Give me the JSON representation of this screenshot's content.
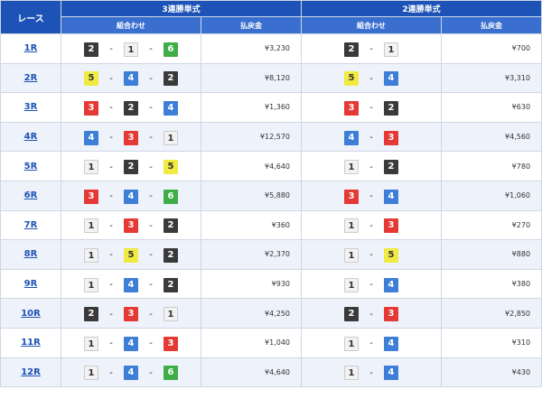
{
  "header": {
    "race": "レース",
    "trifecta": "3連勝単式",
    "exacta": "2連勝単式",
    "combination": "組合わせ",
    "payout": "払戻金",
    "combination2": "組合わせ",
    "payout2": "払戻金"
  },
  "separator": "-",
  "boat_colors": {
    "1": "#f2f2f2",
    "2": "#3a3a3a",
    "3": "#e53935",
    "4": "#3d7fd6",
    "5": "#f1ea43",
    "6": "#3fae49"
  },
  "races": [
    {
      "race": "1R",
      "trifecta": [
        "2",
        "1",
        "6"
      ],
      "trifecta_payout": "¥3,230",
      "exacta": [
        "2",
        "1"
      ],
      "exacta_payout": "¥700"
    },
    {
      "race": "2R",
      "trifecta": [
        "5",
        "4",
        "2"
      ],
      "trifecta_payout": "¥8,120",
      "exacta": [
        "5",
        "4"
      ],
      "exacta_payout": "¥3,310"
    },
    {
      "race": "3R",
      "trifecta": [
        "3",
        "2",
        "4"
      ],
      "trifecta_payout": "¥1,360",
      "exacta": [
        "3",
        "2"
      ],
      "exacta_payout": "¥630"
    },
    {
      "race": "4R",
      "trifecta": [
        "4",
        "3",
        "1"
      ],
      "trifecta_payout": "¥12,570",
      "exacta": [
        "4",
        "3"
      ],
      "exacta_payout": "¥4,560"
    },
    {
      "race": "5R",
      "trifecta": [
        "1",
        "2",
        "5"
      ],
      "trifecta_payout": "¥4,640",
      "exacta": [
        "1",
        "2"
      ],
      "exacta_payout": "¥780"
    },
    {
      "race": "6R",
      "trifecta": [
        "3",
        "4",
        "6"
      ],
      "trifecta_payout": "¥5,880",
      "exacta": [
        "3",
        "4"
      ],
      "exacta_payout": "¥1,060"
    },
    {
      "race": "7R",
      "trifecta": [
        "1",
        "3",
        "2"
      ],
      "trifecta_payout": "¥360",
      "exacta": [
        "1",
        "3"
      ],
      "exacta_payout": "¥270"
    },
    {
      "race": "8R",
      "trifecta": [
        "1",
        "5",
        "2"
      ],
      "trifecta_payout": "¥2,370",
      "exacta": [
        "1",
        "5"
      ],
      "exacta_payout": "¥880"
    },
    {
      "race": "9R",
      "trifecta": [
        "1",
        "4",
        "2"
      ],
      "trifecta_payout": "¥930",
      "exacta": [
        "1",
        "4"
      ],
      "exacta_payout": "¥380"
    },
    {
      "race": "10R",
      "trifecta": [
        "2",
        "3",
        "1"
      ],
      "trifecta_payout": "¥4,250",
      "exacta": [
        "2",
        "3"
      ],
      "exacta_payout": "¥2,850"
    },
    {
      "race": "11R",
      "trifecta": [
        "1",
        "4",
        "3"
      ],
      "trifecta_payout": "¥1,040",
      "exacta": [
        "1",
        "4"
      ],
      "exacta_payout": "¥310"
    },
    {
      "race": "12R",
      "trifecta": [
        "1",
        "4",
        "6"
      ],
      "trifecta_payout": "¥4,640",
      "exacta": [
        "1",
        "4"
      ],
      "exacta_payout": "¥430"
    }
  ]
}
